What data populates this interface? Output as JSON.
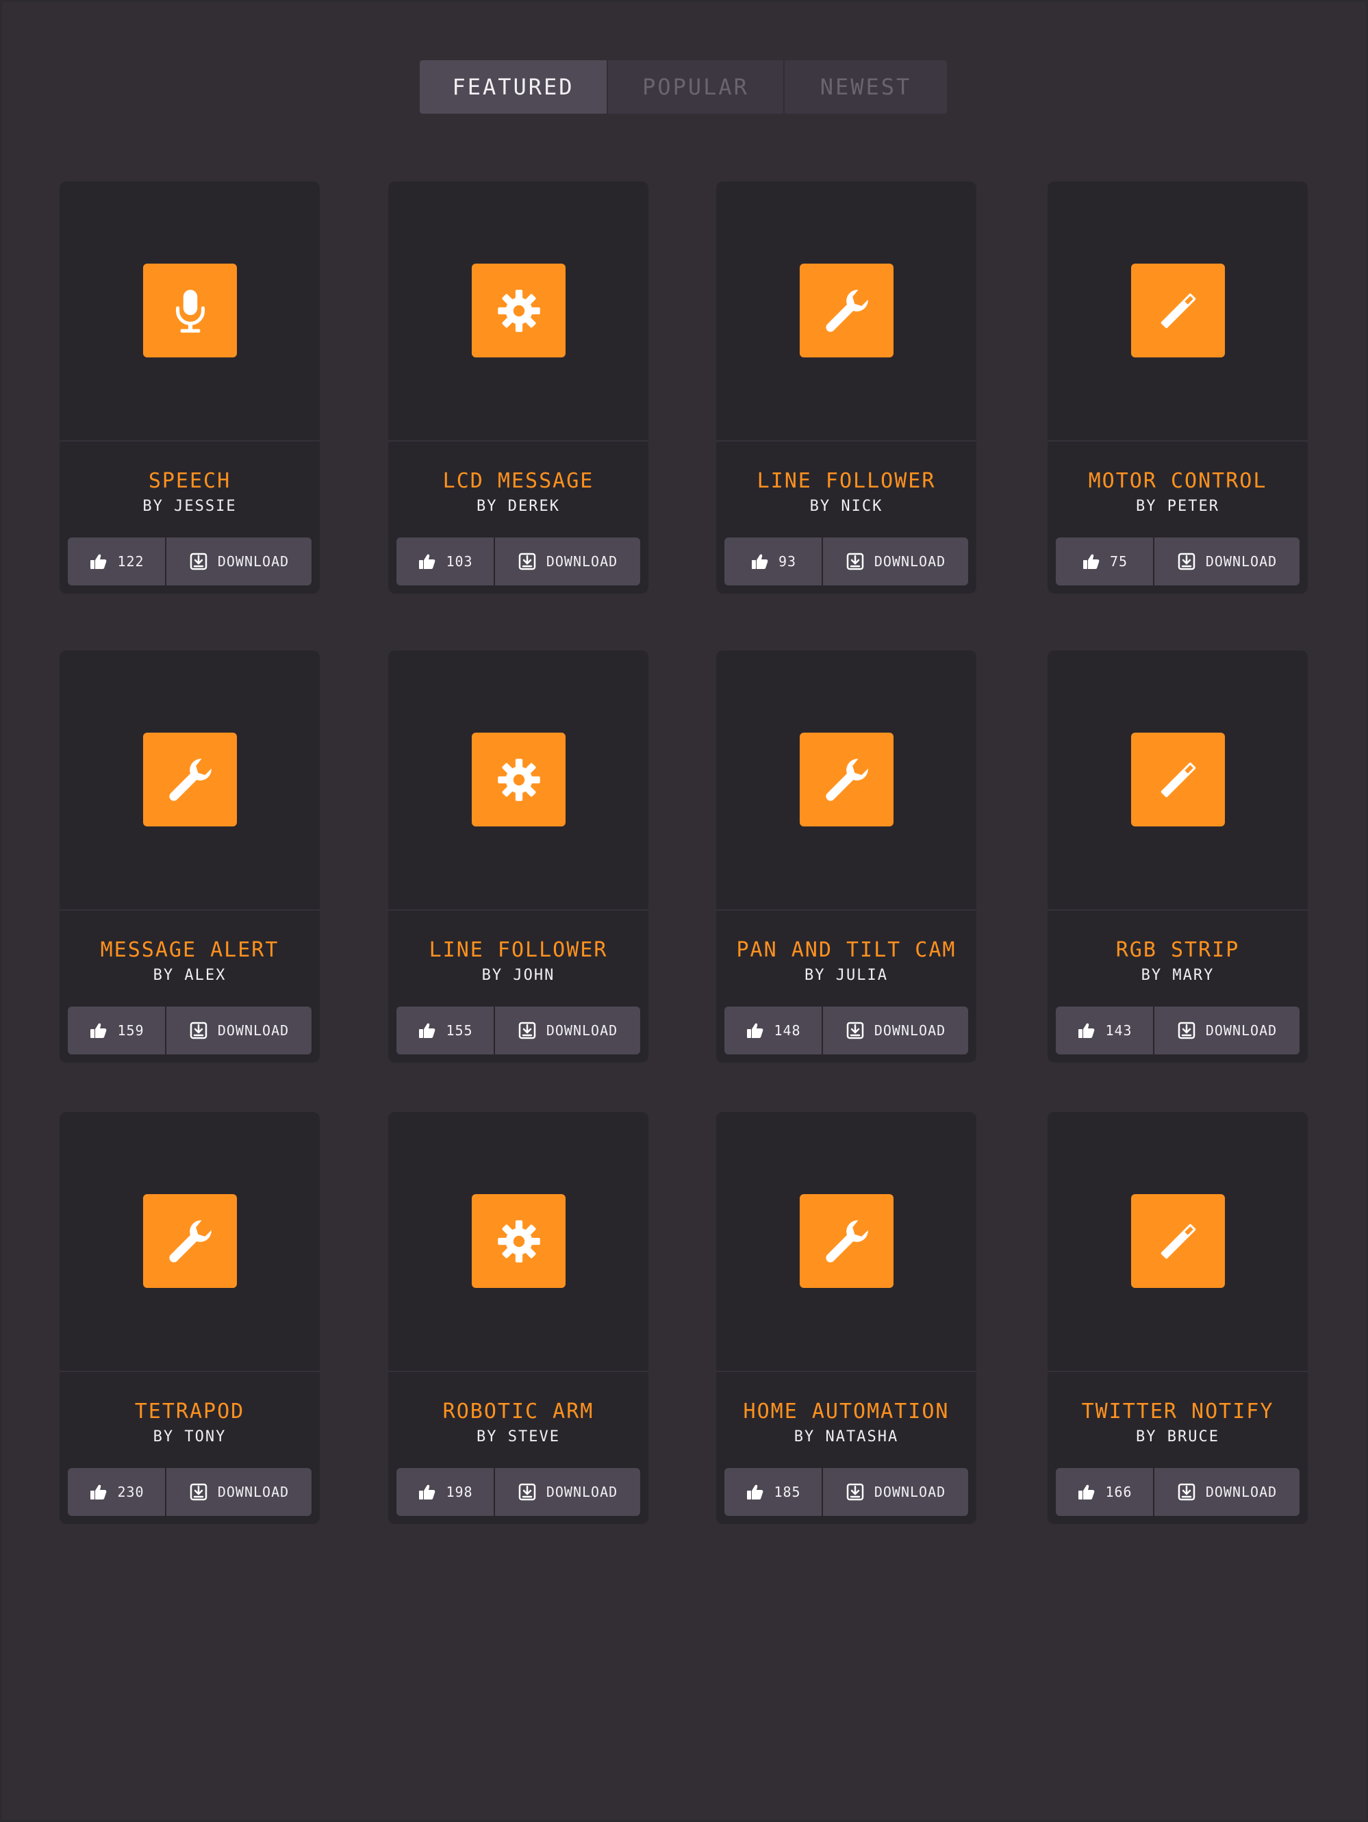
{
  "tabs": [
    {
      "label": "Featured"
    },
    {
      "label": "Popular"
    },
    {
      "label": "Newest"
    }
  ],
  "colors": {
    "background": "#322e34",
    "card": "#29262b",
    "accent": "#ff921f",
    "button": "#4d4853",
    "active_tab": "#4f4a55",
    "inactive_tab": "#3c3741"
  },
  "download_label": "Download",
  "cards": [
    {
      "icon": "microphone-icon",
      "title": "Speech",
      "author": "By Jessie",
      "likes": "122"
    },
    {
      "icon": "gear-icon",
      "title": "LCD Message",
      "author": "By Derek",
      "likes": "103"
    },
    {
      "icon": "wrench-icon",
      "title": "Line Follower",
      "author": "By Nick",
      "likes": "93"
    },
    {
      "icon": "magic-wand-icon",
      "title": "Motor Control",
      "author": "By Peter",
      "likes": "75"
    },
    {
      "icon": "wrench-icon",
      "title": "Message Alert",
      "author": "By Alex",
      "likes": "159"
    },
    {
      "icon": "gear-icon",
      "title": "Line Follower",
      "author": "By John",
      "likes": "155"
    },
    {
      "icon": "wrench-icon",
      "title": "Pan and Tilt Cam",
      "author": "By Julia",
      "likes": "148"
    },
    {
      "icon": "magic-wand-icon",
      "title": "RGB Strip",
      "author": "By Mary",
      "likes": "143"
    },
    {
      "icon": "wrench-icon",
      "title": "Tetrapod",
      "author": "By Tony",
      "likes": "230"
    },
    {
      "icon": "gear-icon",
      "title": "Robotic Arm",
      "author": "By Steve",
      "likes": "198"
    },
    {
      "icon": "wrench-icon",
      "title": "Home Automation",
      "author": "By Natasha",
      "likes": "185"
    },
    {
      "icon": "magic-wand-icon",
      "title": "Twitter Notify",
      "author": "By Bruce",
      "likes": "166"
    }
  ]
}
